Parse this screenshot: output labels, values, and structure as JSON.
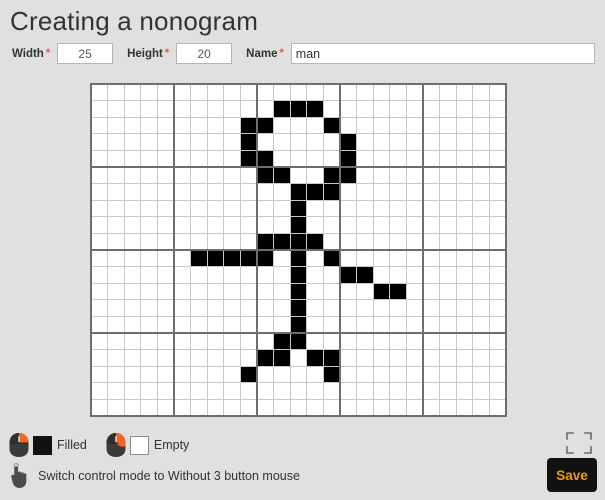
{
  "header": {
    "title": "Creating a nonogram"
  },
  "form": {
    "width": {
      "label": "Width",
      "value": "25",
      "required": "*",
      "placeholder": ""
    },
    "height": {
      "label": "Height",
      "value": "20",
      "required": "*",
      "placeholder": ""
    },
    "name": {
      "label": "Name",
      "value": "man",
      "required": "*",
      "placeholder": ""
    }
  },
  "grid": {
    "cols": 25,
    "rows": 20,
    "block_size": 5,
    "filled_color": "#000000",
    "empty_color": "#ffffff",
    "grid_line_color": "#c8c8c8",
    "block_line_color": "#6e6e6e",
    "cells": [
      [],
      [
        11,
        12,
        13
      ],
      [
        9,
        10,
        14
      ],
      [
        9,
        15
      ],
      [
        9,
        10,
        15
      ],
      [
        10,
        11,
        14,
        15
      ],
      [
        12,
        13,
        14
      ],
      [
        12
      ],
      [
        12
      ],
      [
        10,
        11,
        12,
        13
      ],
      [
        6,
        7,
        8,
        9,
        10,
        12,
        14
      ],
      [
        12,
        15,
        16
      ],
      [
        12,
        17,
        18
      ],
      [
        12
      ],
      [
        12
      ],
      [
        11,
        12
      ],
      [
        10,
        11,
        13,
        14
      ],
      [
        9,
        14
      ],
      [],
      []
    ]
  },
  "legend": {
    "items": [
      {
        "mouse": "left-mouse-button-icon",
        "swatch": "black",
        "label": "Filled"
      },
      {
        "mouse": "right-mouse-button-icon",
        "swatch": "white",
        "label": "Empty"
      }
    ]
  },
  "footer": {
    "switch_mode_label": "Switch control mode to Without 3 button mouse",
    "switch_icon": "tap-hand-icon",
    "fullscreen_icon": "fullscreen-expand-icon",
    "save_label": "Save",
    "save_bg": "#111111",
    "save_text_color": "#f59a0b"
  },
  "colors": {
    "page_background": "#e0e0e0",
    "accent_orange": "#f26522",
    "required_star": "#e8533f"
  }
}
